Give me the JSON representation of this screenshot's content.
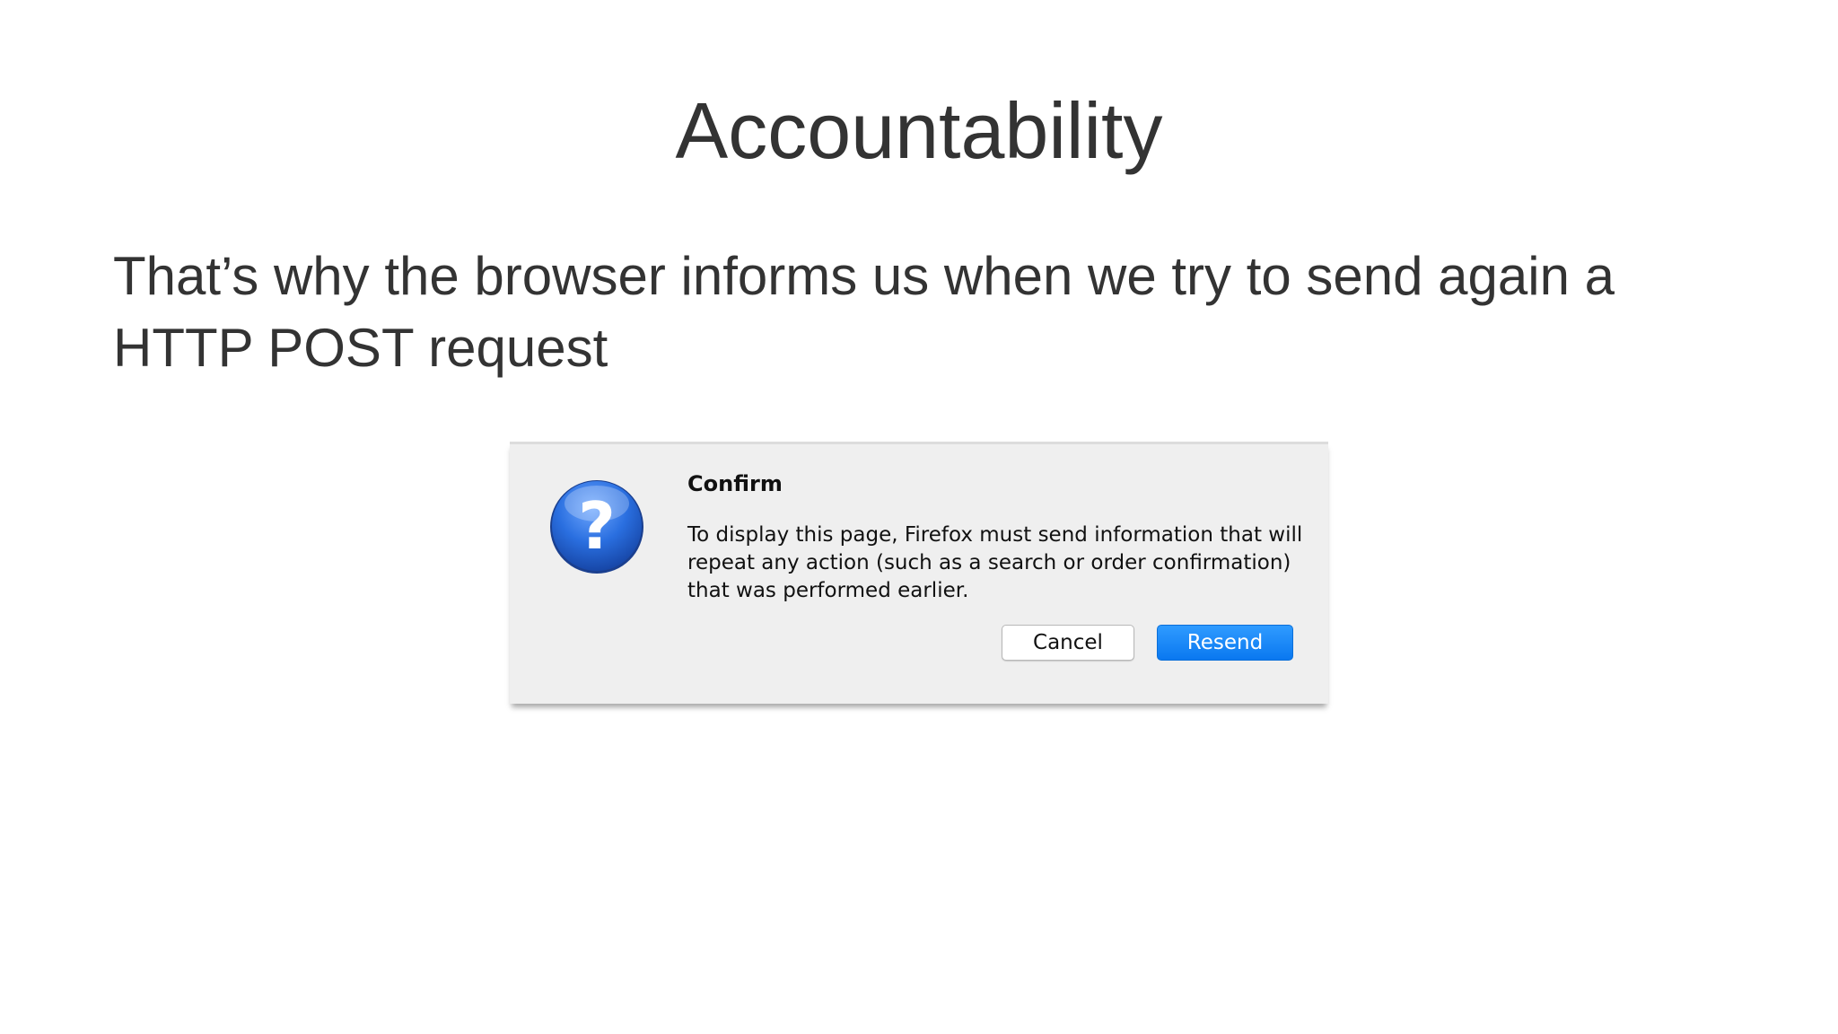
{
  "slide": {
    "title": "Accountability",
    "body": "That’s why the browser informs us when we try to send again a HTTP POST request"
  },
  "dialog": {
    "icon": "question-icon",
    "heading": "Confirm",
    "message": "To display this page, Firefox must send information that will repeat any action (such as a search or order confirmation) that was performed earlier.",
    "cancel_label": "Cancel",
    "resend_label": "Resend",
    "colors": {
      "primary_button": "#0a84ff",
      "icon_blue": "#1f5fd6"
    }
  }
}
